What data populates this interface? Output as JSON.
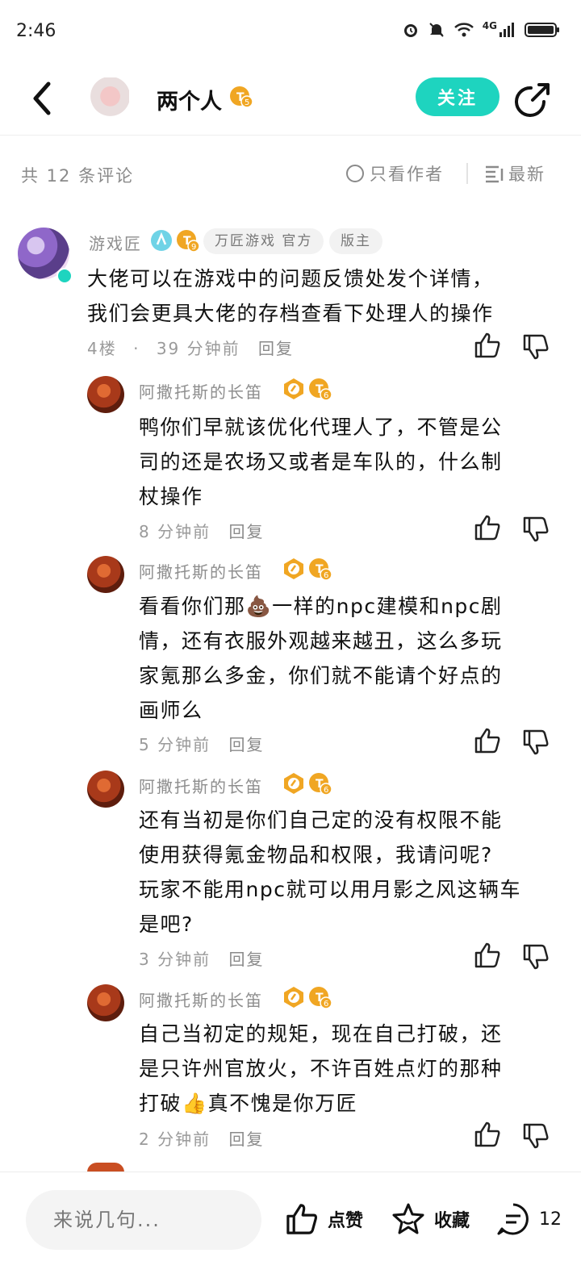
{
  "status_bar": {
    "time": "2:46",
    "network": "4G"
  },
  "header": {
    "post_title": "两个人",
    "level_badge": "5",
    "follow_label": "关注"
  },
  "filter": {
    "comment_count": "共 12 条评论",
    "author_only": "只看作者",
    "sort": "最新"
  },
  "main_comment": {
    "user": "游戏匠",
    "level_badge": "9",
    "tags": [
      "万匠游戏 官方",
      "版主"
    ],
    "text_lines": [
      "大佬可以在游戏中的问题反馈处发个详情，",
      "我们会更具大佬的存档查看下处理人的操作"
    ],
    "floor": "4楼",
    "separator": "·",
    "time": "39 分钟前",
    "reply_label": "回复"
  },
  "replies": [
    {
      "user": "阿撒托斯的长笛",
      "level_badge": "6",
      "text_lines": [
        "鸭你们早就该优化代理人了，不管是公",
        "司的还是农场又或者是车队的，什么制",
        "杖操作"
      ],
      "time": "8 分钟前",
      "reply_label": "回复"
    },
    {
      "user": "阿撒托斯的长笛",
      "level_badge": "6",
      "text_lines": [
        "看看你们那💩一样的npc建模和npc剧",
        "情，还有衣服外观越来越丑，这么多玩",
        "家氪那么多金，你们就不能请个好点的",
        "画师么"
      ],
      "time": "5 分钟前",
      "reply_label": "回复"
    },
    {
      "user": "阿撒托斯的长笛",
      "level_badge": "6",
      "text_lines": [
        "还有当初是你们自己定的没有权限不能",
        "使用获得氪金物品和权限，我请问呢?",
        "玩家不能用npc就可以用月影之风这辆车",
        "是吧?"
      ],
      "time": "3 分钟前",
      "reply_label": "回复"
    },
    {
      "user": "阿撒托斯的长笛",
      "level_badge": "6",
      "text_lines": [
        "自己当初定的规矩，现在自己打破，还",
        "是只许州官放火，不许百姓点灯的那种",
        "打破👍真不愧是你万匠"
      ],
      "time": "2 分钟前",
      "reply_label": "回复"
    }
  ],
  "bottom_bar": {
    "input_placeholder": "来说几句...",
    "like_label": "点赞",
    "favorite_label": "收藏",
    "comment_count": "12"
  },
  "colors": {
    "accent": "#1ed4bf",
    "badge_orange": "#f0a623"
  }
}
